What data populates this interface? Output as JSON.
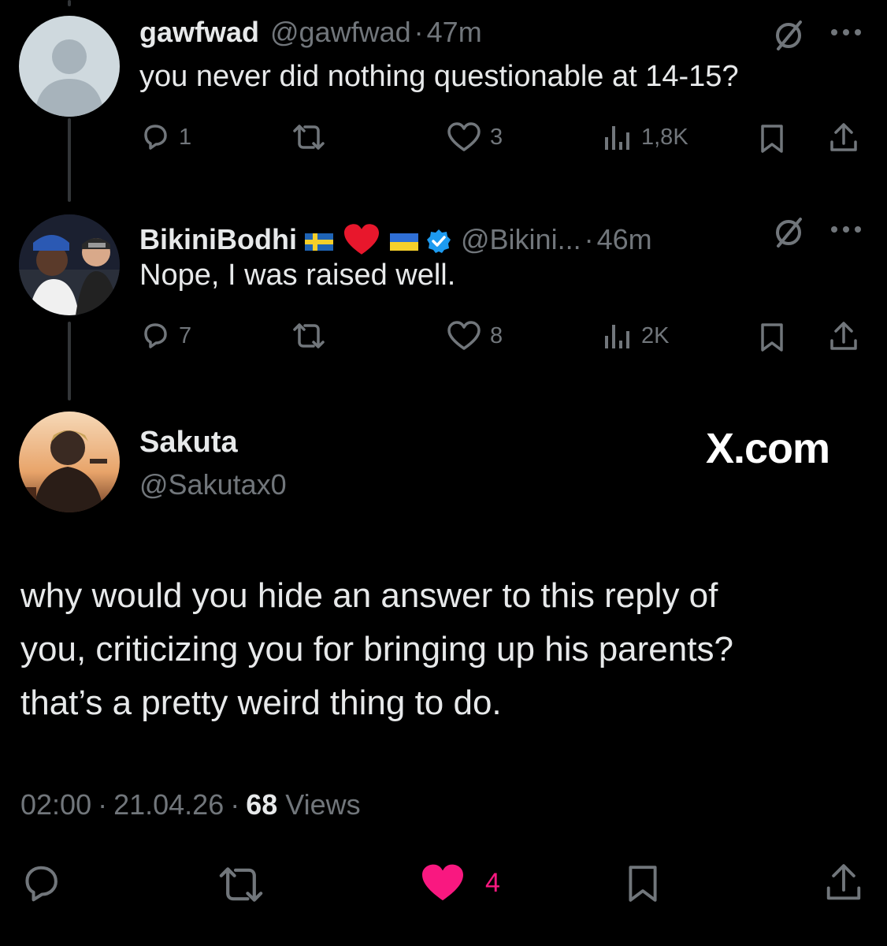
{
  "tweets": [
    {
      "display_name": "gawfwad",
      "handle": "@gawfwad",
      "sep": "·",
      "time": "47m",
      "text": "you never did nothing questionable at 14-15?",
      "replies": "1",
      "likes": "3",
      "views": "1,8K",
      "avatar": "default-avatar-icon"
    },
    {
      "display_name": "BikiniBodhi",
      "handle": "@Bikini...",
      "sep": "·",
      "time": "46m",
      "text": "Nope, I was raised well.",
      "replies": "7",
      "likes": "8",
      "views": "2K",
      "name_emoji": [
        "sweden-flag",
        "red-heart",
        "ukraine-flag",
        "verified-badge"
      ]
    }
  ],
  "main_tweet": {
    "display_name": "Sakuta",
    "handle": "@Sakutax0",
    "watermark": "X.com",
    "text_lines": [
      "why would you hide an answer to this reply of",
      "you, criticizing you for bringing up his parents?",
      "that’s a pretty weird thing to do."
    ],
    "time": "02:00",
    "date": "21.04.26",
    "sep": "·",
    "views_count": "68",
    "views_label": "Views",
    "likes": "4"
  },
  "colors": {
    "background": "#000000",
    "text": "#e7e9ea",
    "muted": "#71767b",
    "like_pink": "#f91880",
    "verified_blue": "#1d9bf0"
  }
}
